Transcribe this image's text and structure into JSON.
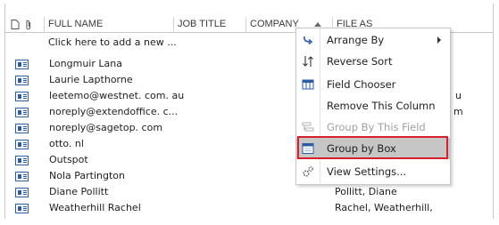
{
  "header": {
    "columns": [
      {
        "label": "FULL NAME"
      },
      {
        "label": "JOB TITLE"
      },
      {
        "label": "COMPANY"
      },
      {
        "label": "FILE AS"
      }
    ]
  },
  "add_new_text": "Click here to add a new ...",
  "rows": [
    {
      "name": "Longmuir Lana",
      "file_as": ""
    },
    {
      "name": "Laurie Lapthorne",
      "file_as": ""
    },
    {
      "name": "leetemo@westnet. com. au",
      "file_as": "u"
    },
    {
      "name": "noreply@extendoffice. c...",
      "file_as": "m"
    },
    {
      "name": "noreply@sagetop. com",
      "file_as": ""
    },
    {
      "name": "otto. nl",
      "file_as": ""
    },
    {
      "name": "Outspot",
      "file_as": ""
    },
    {
      "name": "Nola Partington",
      "file_as": ""
    },
    {
      "name": "Diane Pollitt",
      "file_as": "Pollitt, Diane"
    },
    {
      "name": "Weatherhill Rachel",
      "file_as": "Rachel, Weatherhill,"
    }
  ],
  "context_menu": {
    "items": [
      {
        "label": "Arrange By",
        "icon": "arrange-by-icon",
        "submenu": true
      },
      {
        "label": "Reverse Sort",
        "icon": "reverse-sort-icon"
      },
      {
        "label": "Field Chooser",
        "icon": "field-chooser-icon"
      },
      {
        "label": "Remove This Column",
        "icon": ""
      },
      {
        "label": "Group By This Field",
        "icon": "group-by-field-icon",
        "disabled": true
      },
      {
        "label": "Group by Box",
        "icon": "group-by-box-icon",
        "selected": true
      },
      {
        "label": "View Settings...",
        "icon": "view-settings-icon"
      }
    ]
  },
  "colors": {
    "highlight_border": "#d6212b",
    "selected_bg": "#c6c6c6",
    "icon_blue": "#2a5da8"
  }
}
